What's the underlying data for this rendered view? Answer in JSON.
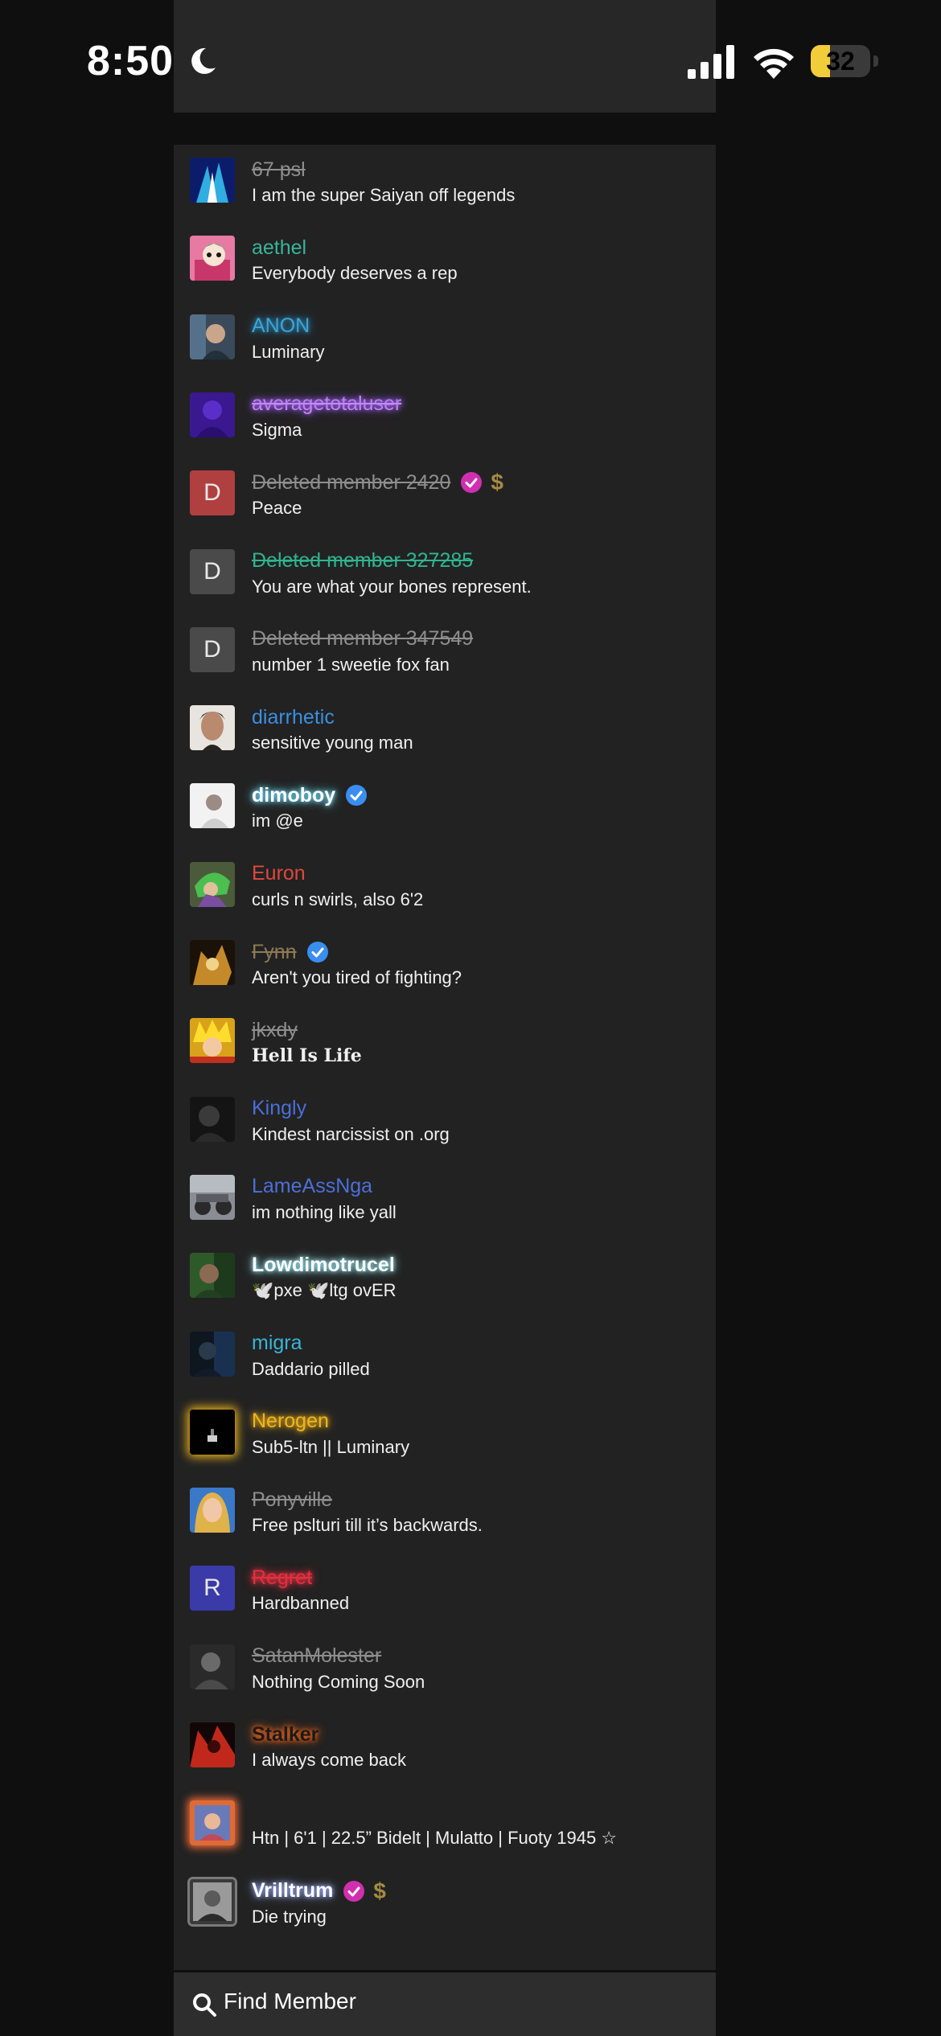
{
  "status_bar": {
    "time": "8:50",
    "battery": "32",
    "battery_level": 0.32
  },
  "members": [
    {
      "name": "67 psl",
      "bio": "I am the super Saiyan off legends",
      "name_color": "#8e8e8e",
      "strike": true,
      "avatar_icon": "blue-energy-avatar"
    },
    {
      "name": "aethel",
      "bio": "Everybody deserves a rep",
      "name_color": "#38b49a",
      "avatar_icon": "anime-pink-avatar"
    },
    {
      "name": "ANON",
      "bio": "Luminary",
      "name_color": "#3aa5d6",
      "glow": "#2f8fc0",
      "avatar_icon": "man-portrait-avatar"
    },
    {
      "name": "averagetotaluser",
      "bio": "Sigma",
      "name_color": "#c48bf0",
      "strike": true,
      "glow": "#9d5cf0",
      "avatar_icon": "purple-avatar"
    },
    {
      "name": "Deleted member 2420",
      "bio": "Peace",
      "name_color": "#8e8e8e",
      "strike": true,
      "avatar_letter": "D",
      "avatar_color": "#b0403f",
      "verified_color": "#d02fb0",
      "dollar": "$"
    },
    {
      "name": "Deleted member 327285",
      "bio": "You are what your bones represent.",
      "name_color": "#2fb58e",
      "strike": true,
      "avatar_letter": "D",
      "avatar_color": "#4a4a4a"
    },
    {
      "name": "Deleted member 347549",
      "bio": "number 1 sweetie fox fan",
      "name_color": "#8e8e8e",
      "strike": true,
      "avatar_letter": "D",
      "avatar_color": "#4a4a4a"
    },
    {
      "name": "diarrhetic",
      "bio": "sensitive young man",
      "name_color": "#3b8fe0",
      "avatar_icon": "face-portrait-avatar"
    },
    {
      "name": "dimoboy",
      "bio": "im @e",
      "name_color": "#ffffff",
      "bold": true,
      "glow": "#6fe0ff",
      "verified_color": "#3a8ef0",
      "avatar_icon": "white-photo-avatar"
    },
    {
      "name": "Euron",
      "bio": "curls n swirls, also 6'2",
      "name_color": "#e0483c",
      "avatar_icon": "green-hair-avatar"
    },
    {
      "name": "Fynn",
      "bio": "Aren't you tired of fighting?",
      "name_color": "#8e7a55",
      "strike": true,
      "verified_color": "#3a8ef0",
      "avatar_icon": "golden-avatar"
    },
    {
      "name": "jkxdy",
      "bio": "Hell Is Life",
      "name_color": "#8e8e8e",
      "strike": true,
      "bio_serif": true,
      "avatar_icon": "yellow-hair-avatar"
    },
    {
      "name": "Kingly",
      "bio": "Kindest narcissist on .org",
      "name_color": "#4b6fd6",
      "avatar_icon": "dark-portrait-avatar"
    },
    {
      "name": "LameAssNga",
      "bio": "im nothing like yall",
      "name_color": "#4d6fd8",
      "avatar_icon": "car-avatar"
    },
    {
      "name": "Lowdimotrucel",
      "bio": "🕊️pxe 🕊️ltg ovER",
      "name_color": "#ffffff",
      "bold": true,
      "glow": "#9ff2ff",
      "avatar_icon": "green-photo-avatar"
    },
    {
      "name": "migra",
      "bio": "Daddario pilled",
      "name_color": "#3cb3d8",
      "avatar_icon": "dark-blue-avatar"
    },
    {
      "name": "Nerogen",
      "bio": "Sub5-ltn || Luminary",
      "name_color": "#f0b51c",
      "glow": "#f0b51c",
      "avatar_icon": "black-frame-avatar",
      "avatar_glow": "gold"
    },
    {
      "name": "Ponyville",
      "bio": "Free pslturi till it’s backwards.",
      "name_color": "#8e8e8e",
      "strike": true,
      "avatar_icon": "blonde-avatar"
    },
    {
      "name": "Regret",
      "bio": "Hardbanned",
      "name_color": "#e03040",
      "strike": true,
      "glow": "#e03040",
      "avatar_letter": "R",
      "avatar_color": "#3a3aa8"
    },
    {
      "name": "SatanMolester",
      "bio": "Nothing Coming Soon",
      "name_color": "#8e8e8e",
      "strike": true,
      "avatar_icon": "bw-portrait-avatar"
    },
    {
      "name": "Stalker",
      "bio": "I always come back",
      "name_color": "#1a1a1a",
      "bold": true,
      "glow": "#ff6a1a",
      "avatar_icon": "red-dark-avatar"
    },
    {
      "name": "",
      "bio": "Htn | 6'1 | 22.5” Bidelt | Mulatto | Fuoty 1945 ☆",
      "name_color": "#ffffff",
      "avatar_icon": "orange-frame-avatar",
      "avatar_glow": "orange"
    },
    {
      "name": "Vrilltrum",
      "bio": "Die trying",
      "name_color": "#ffffff",
      "bold": true,
      "glow": "#9fb0ff",
      "verified_color": "#d02fb0",
      "dollar": "$",
      "avatar_icon": "gray-frame-avatar",
      "avatar_frame": "gray"
    }
  ],
  "search": {
    "label": "Find Member"
  }
}
